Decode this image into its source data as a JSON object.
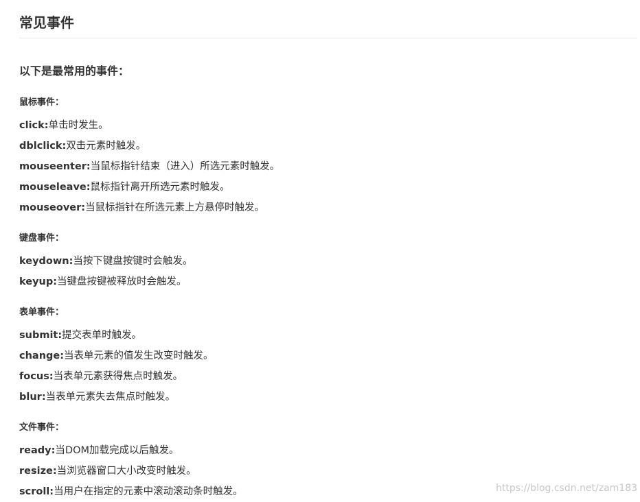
{
  "title": "常见事件",
  "intro": "以下是最常用的事件：",
  "sections": [
    {
      "heading": "鼠标事件：",
      "items": [
        {
          "name": "click:",
          "desc": "单击时发生。"
        },
        {
          "name": "dblclick:",
          "desc": "双击元素时触发。"
        },
        {
          "name": "mouseenter:",
          "desc": "当鼠标指针结束（进入）所选元素时触发。"
        },
        {
          "name": "mouseleave:",
          "desc": "鼠标指针离开所选元素时触发。"
        },
        {
          "name": "mouseover:",
          "desc": "当鼠标指针在所选元素上方悬停时触发。"
        }
      ]
    },
    {
      "heading": "键盘事件：",
      "items": [
        {
          "name": "keydown:",
          "desc": "当按下键盘按键时会触发。"
        },
        {
          "name": "keyup:",
          "desc": "当键盘按键被释放时会触发。"
        }
      ]
    },
    {
      "heading": "表单事件：",
      "items": [
        {
          "name": "submit:",
          "desc": "提交表单时触发。"
        },
        {
          "name": "change:",
          "desc": "当表单元素的值发生改变时触发。"
        },
        {
          "name": "focus:",
          "desc": "当表单元素获得焦点时触发。"
        },
        {
          "name": "blur:",
          "desc": "当表单元素失去焦点时触发。"
        }
      ]
    },
    {
      "heading": "文件事件：",
      "items": [
        {
          "name": "ready:",
          "desc": "当DOM加载完成以后触发。"
        },
        {
          "name": "resize:",
          "desc": "当浏览器窗口大小改变时触发。"
        },
        {
          "name": "scroll:",
          "desc": "当用户在指定的元素中滚动滚动条时触发。"
        }
      ]
    }
  ],
  "watermark": "https://blog.csdn.net/zam183"
}
